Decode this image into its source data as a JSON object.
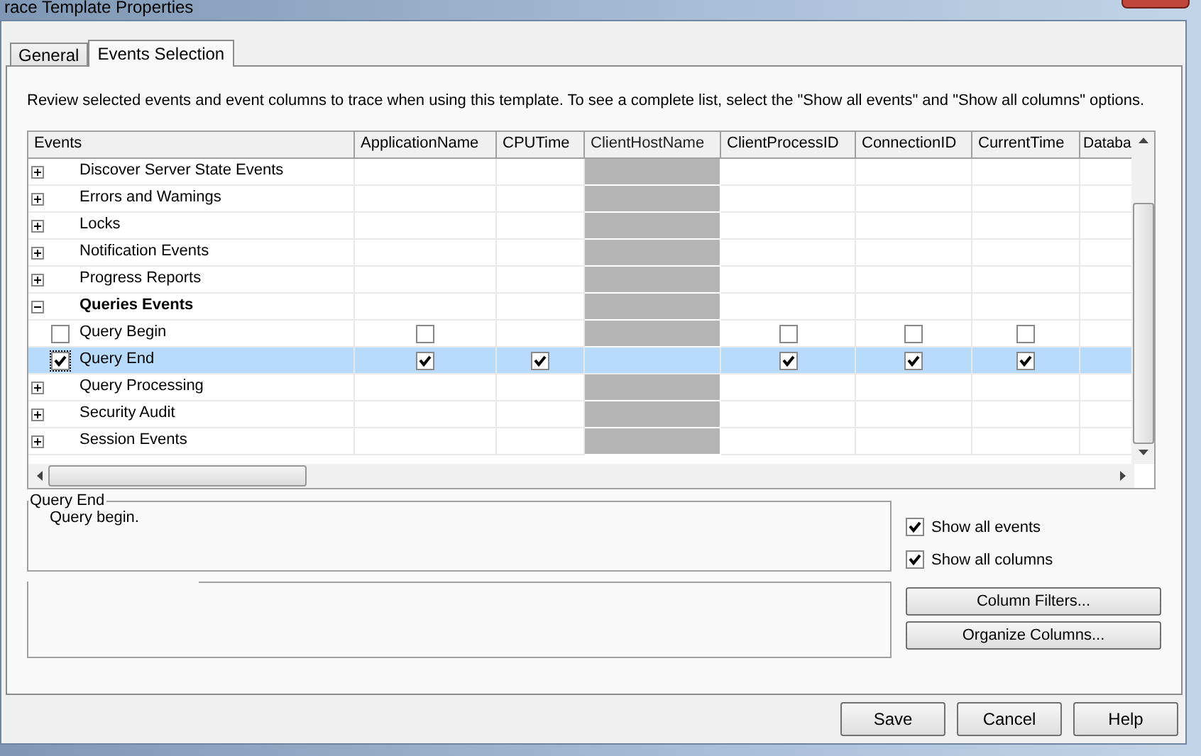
{
  "window": {
    "title": "race Template Properties"
  },
  "tabs": [
    {
      "label": "General",
      "selected": false
    },
    {
      "label": "Events Selection",
      "selected": true
    }
  ],
  "instructions": "Review selected events and event columns to trace when using this template. To see a complete list, select the \"Show all events\" and \"Show all columns\" options.",
  "table": {
    "columns": [
      {
        "label": "Events",
        "disabled": false
      },
      {
        "label": "ApplicationName",
        "disabled": false
      },
      {
        "label": "CPUTime",
        "disabled": false
      },
      {
        "label": "ClientHostName",
        "disabled": true
      },
      {
        "label": "ClientProcessID",
        "disabled": false
      },
      {
        "label": "ConnectionID",
        "disabled": false
      },
      {
        "label": "CurrentTime",
        "disabled": false
      },
      {
        "label": "Databa",
        "disabled": false
      }
    ],
    "groups": [
      {
        "label": "Discover Server State Events",
        "expanded": false,
        "selected": false
      },
      {
        "label": "Errors and Wamings",
        "expanded": false,
        "selected": false
      },
      {
        "label": "Locks",
        "expanded": false,
        "selected": false
      },
      {
        "label": "Notification Events",
        "expanded": false,
        "selected": false
      },
      {
        "label": "Progress Reports",
        "expanded": false,
        "selected": false
      },
      {
        "label": "Queries Events",
        "expanded": true,
        "selected": false,
        "children": [
          {
            "label": "Query Begin",
            "checked": false,
            "selected": false,
            "cells": [
              {
                "kind": "checkbox",
                "checked": false
              },
              {
                "kind": "blank"
              },
              {
                "kind": "blank"
              },
              {
                "kind": "checkbox",
                "checked": false
              },
              {
                "kind": "checkbox",
                "checked": false
              },
              {
                "kind": "checkbox",
                "checked": false
              },
              {
                "kind": "blank"
              }
            ]
          },
          {
            "label": "Query End",
            "checked": true,
            "selected": true,
            "cells": [
              {
                "kind": "checkbox",
                "checked": true
              },
              {
                "kind": "checkbox",
                "checked": true
              },
              {
                "kind": "blank"
              },
              {
                "kind": "checkbox",
                "checked": true
              },
              {
                "kind": "checkbox",
                "checked": true
              },
              {
                "kind": "checkbox",
                "checked": true
              },
              {
                "kind": "blank"
              }
            ]
          }
        ]
      },
      {
        "label": "Query Processing",
        "expanded": false,
        "selected": false
      },
      {
        "label": "Security Audit",
        "expanded": false,
        "selected": false
      },
      {
        "label": "Session Events",
        "expanded": false,
        "selected": false
      }
    ]
  },
  "description": {
    "title": "Query End",
    "text": "Query begin."
  },
  "options": [
    {
      "label": "Show all events",
      "checked": true
    },
    {
      "label": "Show all columns",
      "checked": true
    }
  ],
  "side_buttons": [
    "Column Filters...",
    "Organize Columns..."
  ],
  "buttons": [
    "Save",
    "Cancel",
    "Help"
  ]
}
